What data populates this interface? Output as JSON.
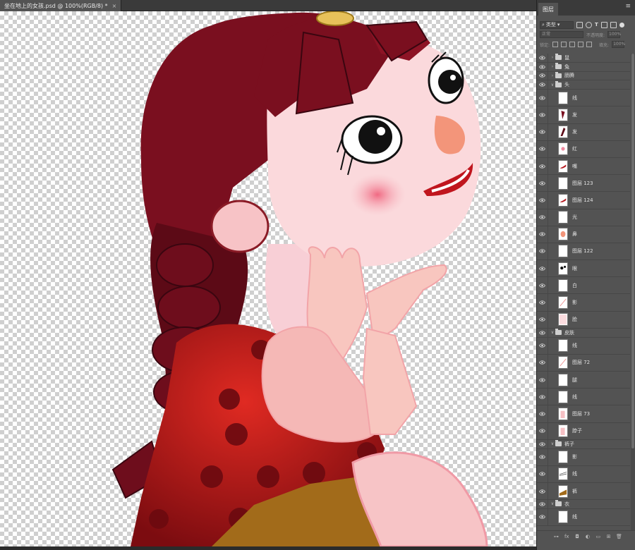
{
  "document_tab": {
    "title": "坐在地上的女孩.psd @ 100%(RGB/8) *",
    "close": "×"
  },
  "panel": {
    "title": "图层",
    "menu": "≡",
    "filter_label": "类型",
    "blend_mode": "正常",
    "opacity_label": "不透明度:",
    "opacity_value": "100%",
    "lock_label": "锁定:",
    "fill_label": "填充:",
    "fill_value": "100%"
  },
  "layers": [
    {
      "name": "鼠",
      "type": "group",
      "expanded": false,
      "indent": 0
    },
    {
      "name": "兔",
      "type": "group",
      "expanded": false,
      "indent": 0
    },
    {
      "name": "肠腾",
      "type": "group",
      "expanded": false,
      "indent": 0
    },
    {
      "name": "头",
      "type": "group",
      "expanded": true,
      "indent": 0
    },
    {
      "name": "线",
      "type": "layer",
      "thumb": "blank"
    },
    {
      "name": "发",
      "type": "layer",
      "thumb": "hair"
    },
    {
      "name": "发",
      "type": "layer",
      "thumb": "hairdark"
    },
    {
      "name": "红",
      "type": "layer",
      "thumb": "dot"
    },
    {
      "name": "嘴",
      "type": "layer",
      "thumb": "mouth"
    },
    {
      "name": "图层 123",
      "type": "layer",
      "thumb": "blank"
    },
    {
      "name": "图层 124",
      "type": "layer",
      "thumb": "mouth"
    },
    {
      "name": "光",
      "type": "layer",
      "thumb": "blank"
    },
    {
      "name": "鼻",
      "type": "layer",
      "thumb": "nose"
    },
    {
      "name": "图层 122",
      "type": "layer",
      "thumb": "blank"
    },
    {
      "name": "眼",
      "type": "layer",
      "thumb": "eye"
    },
    {
      "name": "白",
      "type": "layer",
      "thumb": "blank"
    },
    {
      "name": "影",
      "type": "layer",
      "thumb": "stroke"
    },
    {
      "name": "脸",
      "type": "layer",
      "thumb": "face"
    },
    {
      "name": "皮肤",
      "type": "group",
      "expanded": true,
      "indent": 0
    },
    {
      "name": "线",
      "type": "layer",
      "thumb": "blank"
    },
    {
      "name": "图层 72",
      "type": "layer",
      "thumb": "stroke"
    },
    {
      "name": "腿",
      "type": "layer",
      "thumb": "blank"
    },
    {
      "name": "线",
      "type": "layer",
      "thumb": "blank"
    },
    {
      "name": "图层 73",
      "type": "layer",
      "thumb": "skin"
    },
    {
      "name": "脖子",
      "type": "layer",
      "thumb": "skin"
    },
    {
      "name": "裤子",
      "type": "group",
      "expanded": true,
      "indent": 0
    },
    {
      "name": "影",
      "type": "layer",
      "thumb": "blank"
    },
    {
      "name": "线",
      "type": "layer",
      "thumb": "lines"
    },
    {
      "name": "裤",
      "type": "layer",
      "thumb": "pants"
    },
    {
      "name": "衣",
      "type": "group",
      "expanded": true,
      "indent": 0
    },
    {
      "name": "线",
      "type": "layer",
      "thumb": "blank"
    }
  ],
  "footer_buttons": [
    "link-icon",
    "fx-icon",
    "mask-icon",
    "adjustment-icon",
    "folder-icon",
    "new-layer-icon",
    "trash-icon"
  ],
  "footer_fx": "fx",
  "colors": {
    "hair": "#7a0f1f",
    "dress": "#b5161c",
    "skin": "#f9c9c3",
    "panel": "#535353"
  }
}
